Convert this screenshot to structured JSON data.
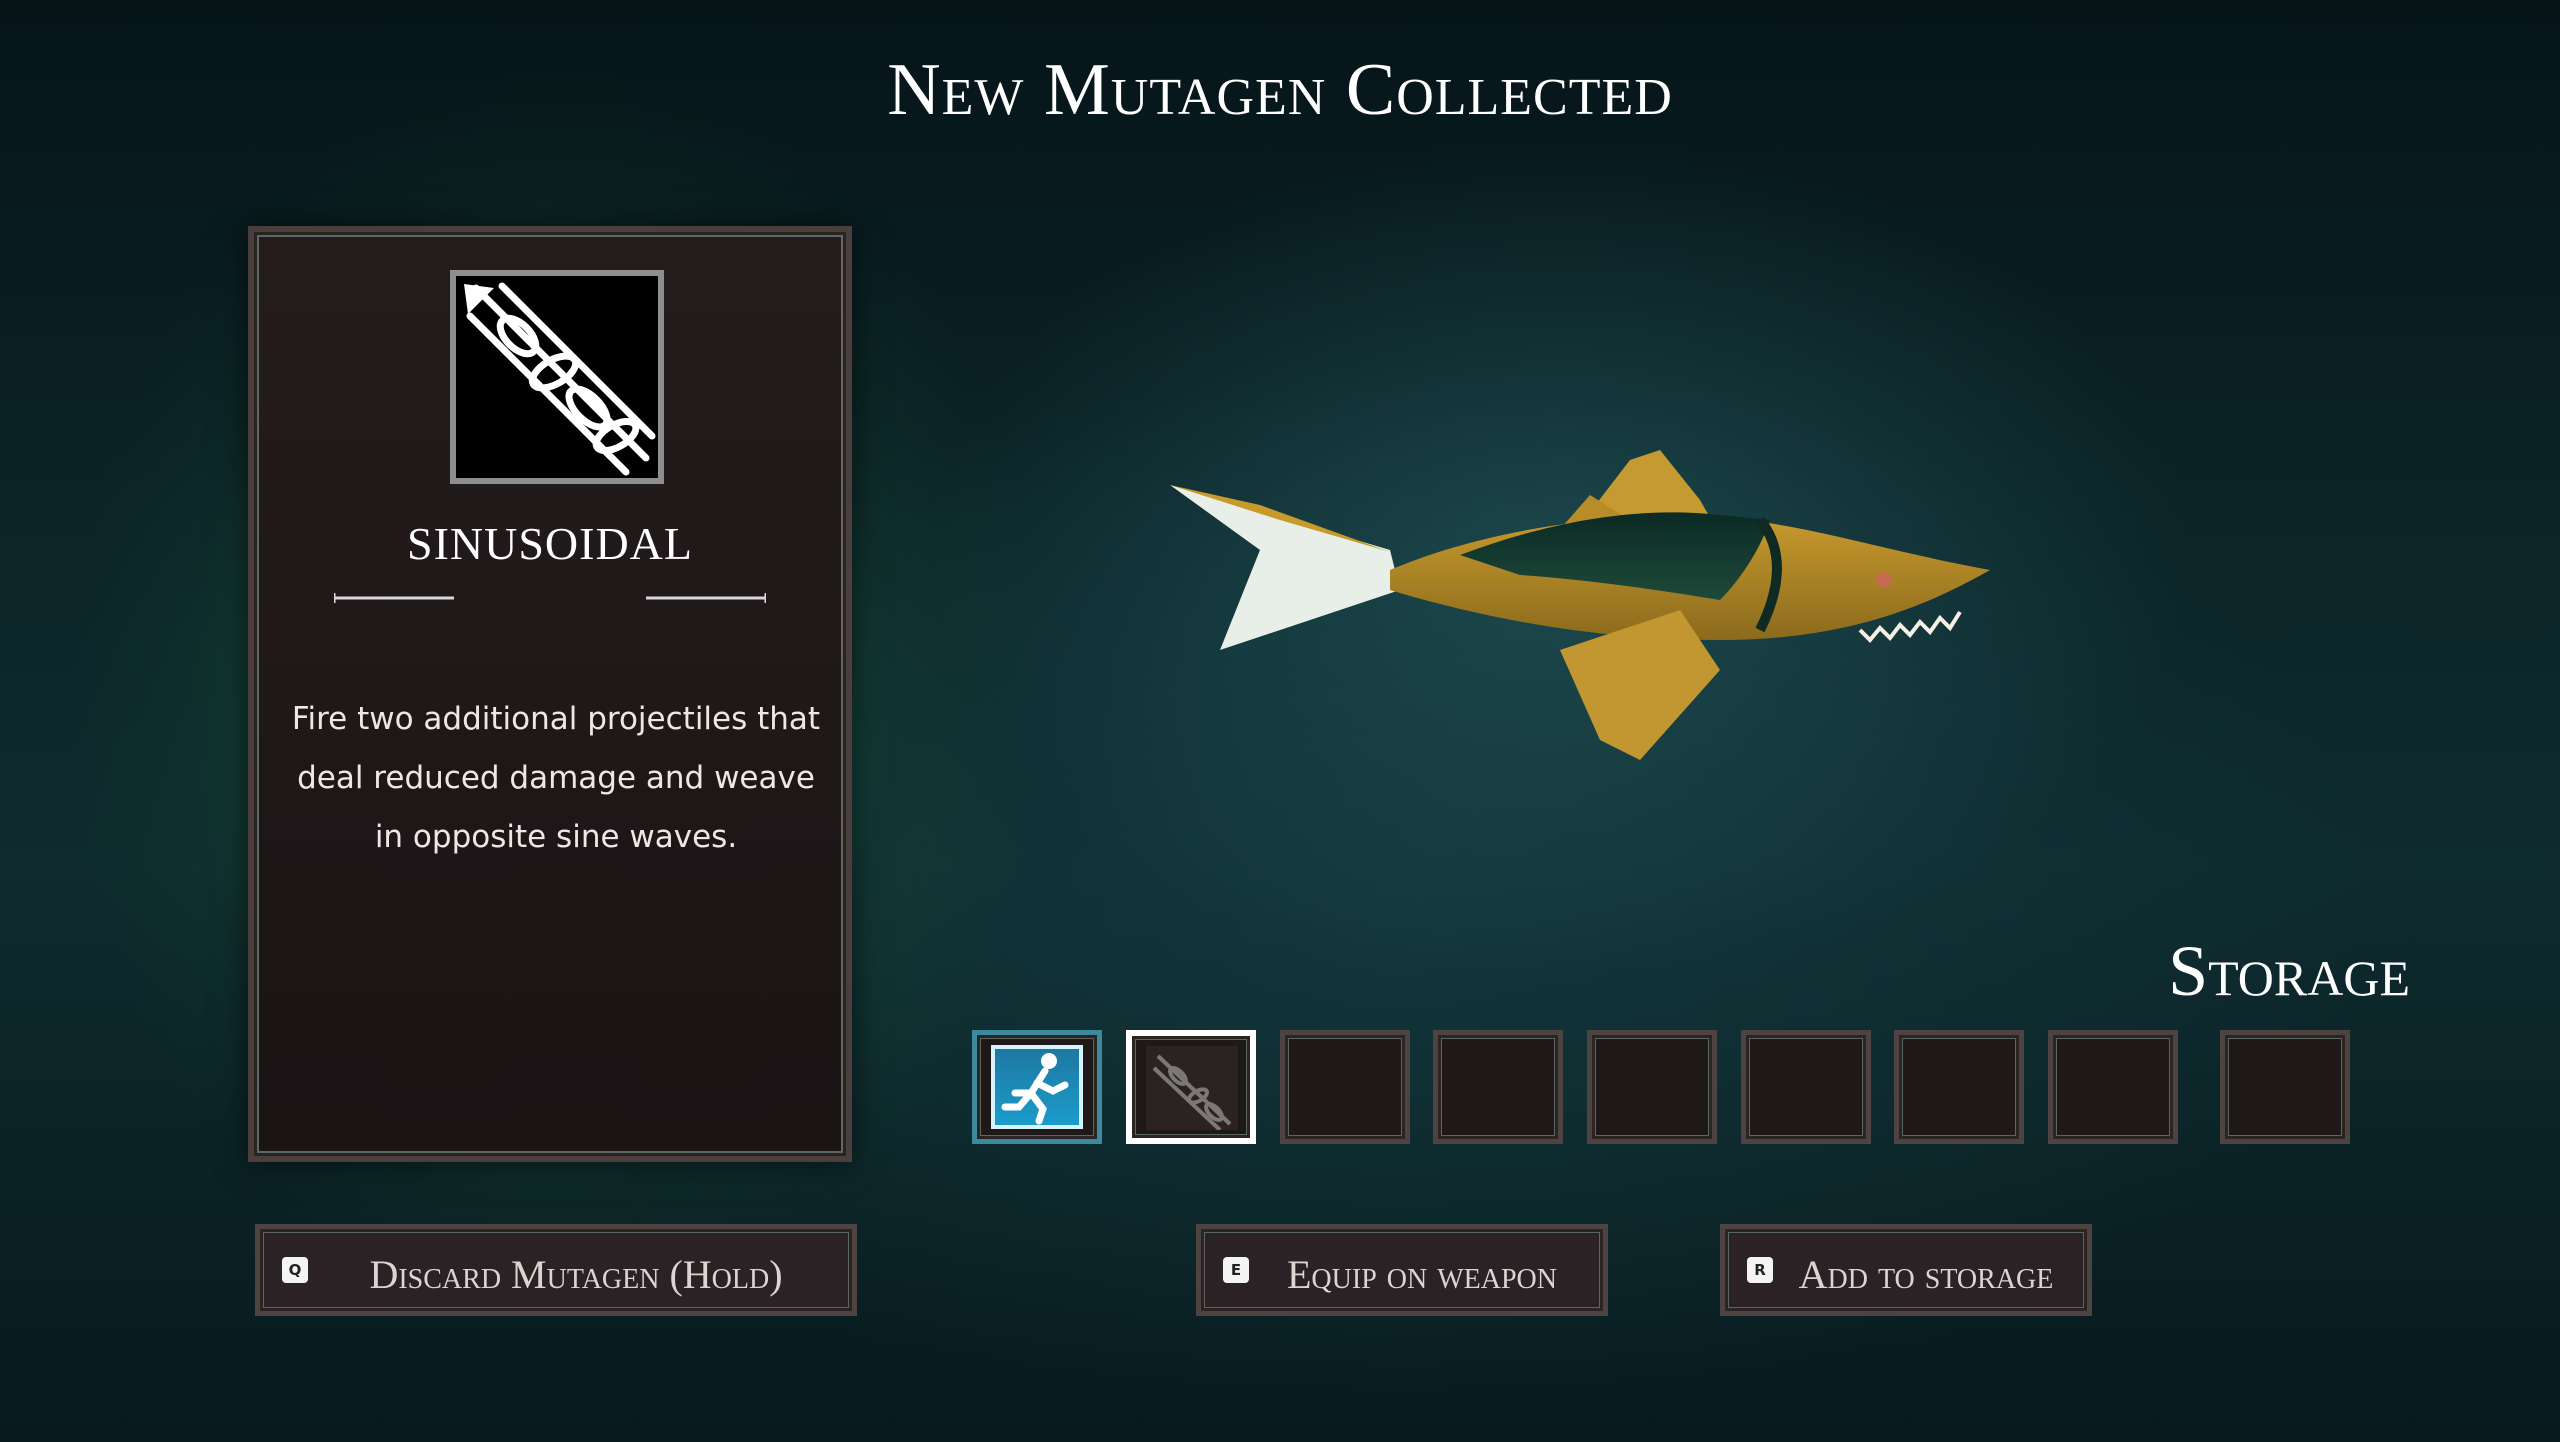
{
  "header": {
    "title": "New Mutagen Collected"
  },
  "mutagen": {
    "name": "SINUSOIDAL",
    "icon": "sinusoidal-projectile-icon",
    "description": "Fire two additional projectiles that deal reduced damage and weave in opposite sine waves."
  },
  "preview": {
    "creature": "fish-model"
  },
  "storage": {
    "label": "Storage",
    "slots": [
      {
        "state": "active",
        "icon": "running-man-icon"
      },
      {
        "state": "selected",
        "icon": "sinusoidal-projectile-icon"
      },
      {
        "state": "empty"
      },
      {
        "state": "empty"
      },
      {
        "state": "empty"
      },
      {
        "state": "empty"
      },
      {
        "state": "empty"
      },
      {
        "state": "empty"
      },
      {
        "state": "empty"
      }
    ]
  },
  "actions": {
    "discard": {
      "key": "Q",
      "label": "Discard Mutagen (Hold)"
    },
    "equip": {
      "key": "E",
      "label": "Equip on weapon"
    },
    "store": {
      "key": "R",
      "label": "Add to storage"
    }
  },
  "colors": {
    "accent": "#1a9ccc",
    "panel": "#1e1718",
    "border": "#4d4441"
  }
}
